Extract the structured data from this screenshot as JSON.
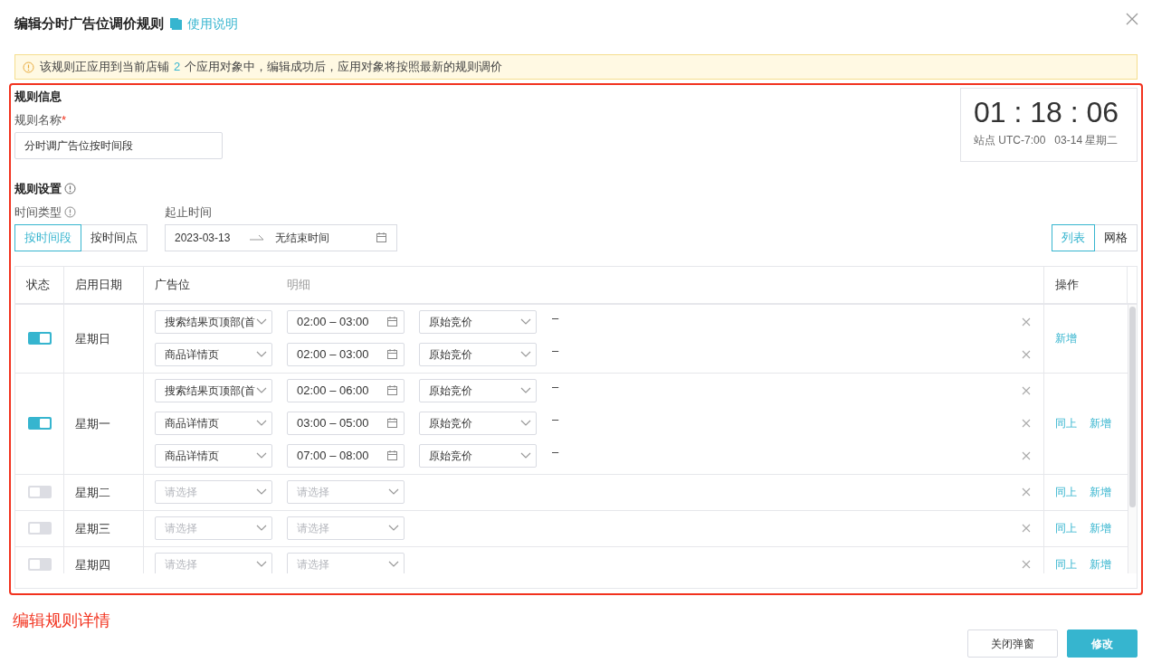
{
  "dialog": {
    "title": "编辑分时广告位调价规则",
    "help_link": "使用说明"
  },
  "notice": {
    "before": "该规则正应用到当前店铺",
    "count": "2",
    "after": "个应用对象中，编辑成功后，应用对象将按照最新的规则调价"
  },
  "rule_info": {
    "heading": "规则信息",
    "name_label": "规则名称",
    "required_mark": "*",
    "name_value": "分时调广告位按时间段"
  },
  "clock": {
    "time": "01 : 18 : 06",
    "zone": "站点 UTC-7:00",
    "date": "03-14 星期二"
  },
  "rule_settings": {
    "heading": "规则设置",
    "time_type_label": "时间类型",
    "time_types": [
      {
        "label": "按时间段",
        "selected": true
      },
      {
        "label": "按时间点",
        "selected": false
      }
    ],
    "range_label": "起止时间",
    "range_start": "2023-03-13",
    "range_end": "无结束时间",
    "views": [
      {
        "label": "列表",
        "selected": true
      },
      {
        "label": "网格",
        "selected": false
      }
    ]
  },
  "table": {
    "columns": [
      {
        "label": "状态",
        "muted": false
      },
      {
        "label": "启用日期",
        "muted": false
      },
      {
        "label": "广告位",
        "muted": false
      },
      {
        "label": "明细",
        "muted": true
      },
      {
        "label": "操作",
        "muted": false
      }
    ],
    "rows": [
      {
        "on": true,
        "day": "星期日",
        "entries": [
          {
            "kind": "filled",
            "placement": "搜索结果页顶部(首",
            "time": "02:00 – 03:00",
            "bid": "原始竞价",
            "adjustment": "–"
          },
          {
            "kind": "filled",
            "placement": "商品详情页",
            "time": "02:00 – 03:00",
            "bid": "原始竞价",
            "adjustment": "–"
          }
        ],
        "actions": [
          "新增"
        ]
      },
      {
        "on": true,
        "day": "星期一",
        "entries": [
          {
            "kind": "filled",
            "placement": "搜索结果页顶部(首",
            "time": "02:00 – 06:00",
            "bid": "原始竞价",
            "adjustment": "–"
          },
          {
            "kind": "filled",
            "placement": "商品详情页",
            "time": "03:00 – 05:00",
            "bid": "原始竞价",
            "adjustment": "–"
          },
          {
            "kind": "filled",
            "placement": "商品详情页",
            "time": "07:00 – 08:00",
            "bid": "原始竞价",
            "adjustment": "–"
          }
        ],
        "actions": [
          "同上",
          "新增"
        ]
      },
      {
        "on": false,
        "day": "星期二",
        "entries": [
          {
            "kind": "empty",
            "placement_placeholder": "请选择",
            "detail_placeholder": "请选择"
          }
        ],
        "actions": [
          "同上",
          "新增"
        ]
      },
      {
        "on": false,
        "day": "星期三",
        "entries": [
          {
            "kind": "empty",
            "placement_placeholder": "请选择",
            "detail_placeholder": "请选择"
          }
        ],
        "actions": [
          "同上",
          "新增"
        ]
      },
      {
        "on": false,
        "day": "星期四",
        "entries": [
          {
            "kind": "empty",
            "placement_placeholder": "请选择",
            "detail_placeholder": "请选择"
          }
        ],
        "actions": [
          "同上",
          "新增"
        ]
      }
    ]
  },
  "annotation": {
    "label": "编辑规则详情"
  },
  "footer": {
    "buttons": [
      {
        "label": "关闭弹窗",
        "primary": false
      },
      {
        "label": "修改",
        "primary": true
      }
    ]
  }
}
